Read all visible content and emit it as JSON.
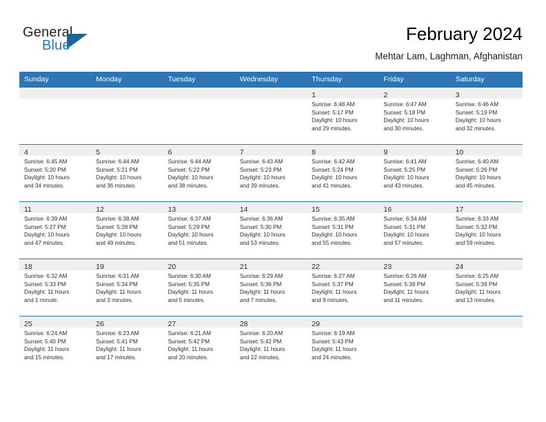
{
  "brand": {
    "name_part1": "General",
    "name_part2": "Blue",
    "triangle_color": "#15659f"
  },
  "header": {
    "title": "February 2024",
    "subtitle": "Mehtar Lam, Laghman, Afghanistan",
    "accent_color": "#2e75b6",
    "band_color": "#efefef"
  },
  "weekdays": [
    "Sunday",
    "Monday",
    "Tuesday",
    "Wednesday",
    "Thursday",
    "Friday",
    "Saturday"
  ],
  "weeks": [
    [
      {
        "day": ""
      },
      {
        "day": ""
      },
      {
        "day": ""
      },
      {
        "day": ""
      },
      {
        "day": "1",
        "sunrise": "Sunrise: 6:48 AM",
        "sunset": "Sunset: 5:17 PM",
        "daylight_line1": "Daylight: 10 hours",
        "daylight_line2": "and 29 minutes."
      },
      {
        "day": "2",
        "sunrise": "Sunrise: 6:47 AM",
        "sunset": "Sunset: 5:18 PM",
        "daylight_line1": "Daylight: 10 hours",
        "daylight_line2": "and 30 minutes."
      },
      {
        "day": "3",
        "sunrise": "Sunrise: 6:46 AM",
        "sunset": "Sunset: 5:19 PM",
        "daylight_line1": "Daylight: 10 hours",
        "daylight_line2": "and 32 minutes."
      }
    ],
    [
      {
        "day": "4",
        "sunrise": "Sunrise: 6:45 AM",
        "sunset": "Sunset: 5:20 PM",
        "daylight_line1": "Daylight: 10 hours",
        "daylight_line2": "and 34 minutes."
      },
      {
        "day": "5",
        "sunrise": "Sunrise: 6:44 AM",
        "sunset": "Sunset: 5:21 PM",
        "daylight_line1": "Daylight: 10 hours",
        "daylight_line2": "and 36 minutes."
      },
      {
        "day": "6",
        "sunrise": "Sunrise: 6:44 AM",
        "sunset": "Sunset: 5:22 PM",
        "daylight_line1": "Daylight: 10 hours",
        "daylight_line2": "and 38 minutes."
      },
      {
        "day": "7",
        "sunrise": "Sunrise: 6:43 AM",
        "sunset": "Sunset: 5:23 PM",
        "daylight_line1": "Daylight: 10 hours",
        "daylight_line2": "and 39 minutes."
      },
      {
        "day": "8",
        "sunrise": "Sunrise: 6:42 AM",
        "sunset": "Sunset: 5:24 PM",
        "daylight_line1": "Daylight: 10 hours",
        "daylight_line2": "and 41 minutes."
      },
      {
        "day": "9",
        "sunrise": "Sunrise: 6:41 AM",
        "sunset": "Sunset: 5:25 PM",
        "daylight_line1": "Daylight: 10 hours",
        "daylight_line2": "and 43 minutes."
      },
      {
        "day": "10",
        "sunrise": "Sunrise: 6:40 AM",
        "sunset": "Sunset: 5:26 PM",
        "daylight_line1": "Daylight: 10 hours",
        "daylight_line2": "and 45 minutes."
      }
    ],
    [
      {
        "day": "11",
        "sunrise": "Sunrise: 6:39 AM",
        "sunset": "Sunset: 5:27 PM",
        "daylight_line1": "Daylight: 10 hours",
        "daylight_line2": "and 47 minutes."
      },
      {
        "day": "12",
        "sunrise": "Sunrise: 6:38 AM",
        "sunset": "Sunset: 5:28 PM",
        "daylight_line1": "Daylight: 10 hours",
        "daylight_line2": "and 49 minutes."
      },
      {
        "day": "13",
        "sunrise": "Sunrise: 6:37 AM",
        "sunset": "Sunset: 5:29 PM",
        "daylight_line1": "Daylight: 10 hours",
        "daylight_line2": "and 51 minutes."
      },
      {
        "day": "14",
        "sunrise": "Sunrise: 6:36 AM",
        "sunset": "Sunset: 5:30 PM",
        "daylight_line1": "Daylight: 10 hours",
        "daylight_line2": "and 53 minutes."
      },
      {
        "day": "15",
        "sunrise": "Sunrise: 6:35 AM",
        "sunset": "Sunset: 5:31 PM",
        "daylight_line1": "Daylight: 10 hours",
        "daylight_line2": "and 55 minutes."
      },
      {
        "day": "16",
        "sunrise": "Sunrise: 6:34 AM",
        "sunset": "Sunset: 5:31 PM",
        "daylight_line1": "Daylight: 10 hours",
        "daylight_line2": "and 57 minutes."
      },
      {
        "day": "17",
        "sunrise": "Sunrise: 6:33 AM",
        "sunset": "Sunset: 5:32 PM",
        "daylight_line1": "Daylight: 10 hours",
        "daylight_line2": "and 59 minutes."
      }
    ],
    [
      {
        "day": "18",
        "sunrise": "Sunrise: 6:32 AM",
        "sunset": "Sunset: 5:33 PM",
        "daylight_line1": "Daylight: 11 hours",
        "daylight_line2": "and 1 minute."
      },
      {
        "day": "19",
        "sunrise": "Sunrise: 6:31 AM",
        "sunset": "Sunset: 5:34 PM",
        "daylight_line1": "Daylight: 11 hours",
        "daylight_line2": "and 3 minutes."
      },
      {
        "day": "20",
        "sunrise": "Sunrise: 6:30 AM",
        "sunset": "Sunset: 5:35 PM",
        "daylight_line1": "Daylight: 11 hours",
        "daylight_line2": "and 5 minutes."
      },
      {
        "day": "21",
        "sunrise": "Sunrise: 6:29 AM",
        "sunset": "Sunset: 5:36 PM",
        "daylight_line1": "Daylight: 11 hours",
        "daylight_line2": "and 7 minutes."
      },
      {
        "day": "22",
        "sunrise": "Sunrise: 6:27 AM",
        "sunset": "Sunset: 5:37 PM",
        "daylight_line1": "Daylight: 11 hours",
        "daylight_line2": "and 9 minutes."
      },
      {
        "day": "23",
        "sunrise": "Sunrise: 6:26 AM",
        "sunset": "Sunset: 5:38 PM",
        "daylight_line1": "Daylight: 11 hours",
        "daylight_line2": "and 11 minutes."
      },
      {
        "day": "24",
        "sunrise": "Sunrise: 6:25 AM",
        "sunset": "Sunset: 5:39 PM",
        "daylight_line1": "Daylight: 11 hours",
        "daylight_line2": "and 13 minutes."
      }
    ],
    [
      {
        "day": "25",
        "sunrise": "Sunrise: 6:24 AM",
        "sunset": "Sunset: 5:40 PM",
        "daylight_line1": "Daylight: 11 hours",
        "daylight_line2": "and 15 minutes."
      },
      {
        "day": "26",
        "sunrise": "Sunrise: 6:23 AM",
        "sunset": "Sunset: 5:41 PM",
        "daylight_line1": "Daylight: 11 hours",
        "daylight_line2": "and 17 minutes."
      },
      {
        "day": "27",
        "sunrise": "Sunrise: 6:21 AM",
        "sunset": "Sunset: 5:42 PM",
        "daylight_line1": "Daylight: 11 hours",
        "daylight_line2": "and 20 minutes."
      },
      {
        "day": "28",
        "sunrise": "Sunrise: 6:20 AM",
        "sunset": "Sunset: 5:42 PM",
        "daylight_line1": "Daylight: 11 hours",
        "daylight_line2": "and 22 minutes."
      },
      {
        "day": "29",
        "sunrise": "Sunrise: 6:19 AM",
        "sunset": "Sunset: 5:43 PM",
        "daylight_line1": "Daylight: 11 hours",
        "daylight_line2": "and 24 minutes."
      },
      {
        "day": ""
      },
      {
        "day": ""
      }
    ]
  ]
}
